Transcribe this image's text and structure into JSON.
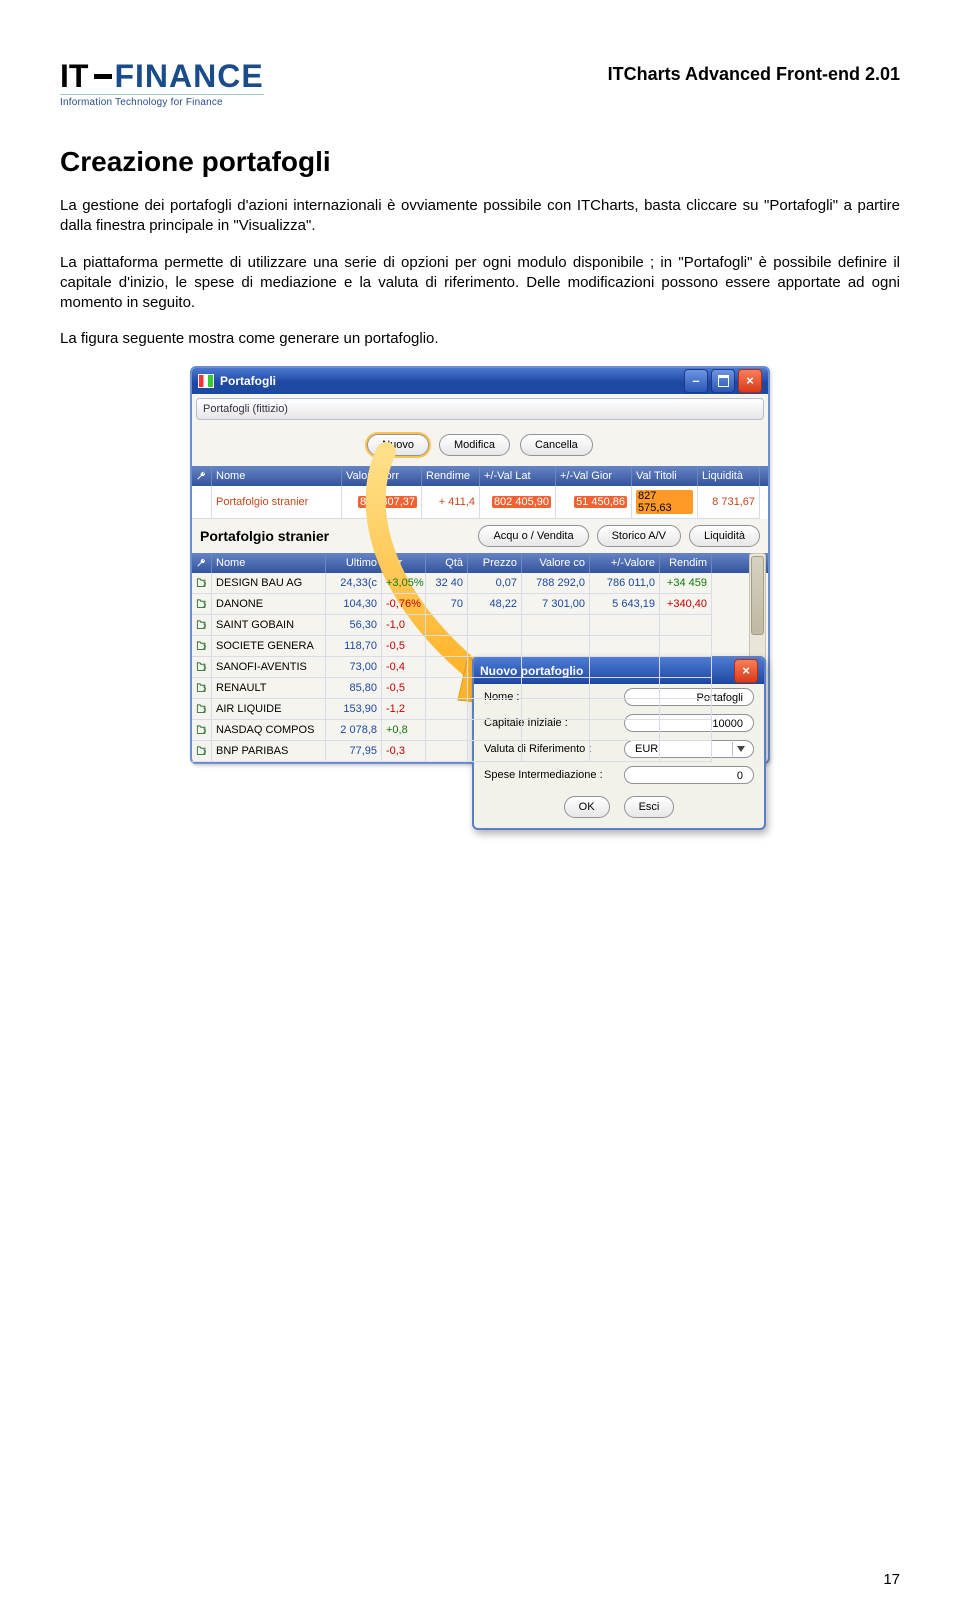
{
  "header": {
    "logo_it": "IT",
    "logo_finance": "FINANCE",
    "logo_sub": "Information Technology for Finance",
    "doc_title": "ITCharts Advanced Front-end 2.01"
  },
  "heading": "Creazione portafogli",
  "para1": "La gestione dei portafogli d'azioni internazionali è ovviamente possibile con ITCharts, basta cliccare su \"Portafogli\" a partire dalla finestra principale in \"Visualizza\".",
  "para2": "La piattaforma permette di utilizzare una serie di opzioni per ogni modulo disponibile ; in \"Portafogli\" è possibile definire il capitale d'inizio, le spese di mediazione e la valuta di riferimento. Delle modificazioni possono essere apportate ad ogni momento in seguito.",
  "para3": "La figura seguente mostra come generare un portafoglio.",
  "win": {
    "title": "Portafogli",
    "rail": "Portafogli (fittizio)",
    "buttons": {
      "nuovo": "Nuovo",
      "modifica": "Modifica",
      "cancella": "Cancella",
      "acq": "Acqu   o / Vendita",
      "storico": "Storico A/V",
      "liq": "Liquidità"
    },
    "portfolio_cols": [
      "Nome",
      "Valore corr",
      "Rendime",
      "+/-Val Lat",
      "+/-Val Gior",
      "Val Titoli",
      "Liquidità"
    ],
    "portfolio_row": {
      "name": "Portafolgio stranier",
      "c1": "836 307,37",
      "c2": "+   411,4",
      "c3": "802 405,90",
      "c4": "51 450,86",
      "c5": "827 575,63",
      "c6": "8 731,67"
    },
    "subtitle": "Portafolgio stranier",
    "asset_cols": [
      "Nome",
      "Ultimo",
      "Var",
      "Qtà",
      "Prezzo",
      "Valore co",
      "+/-Valore",
      "Rendim"
    ],
    "assets": [
      {
        "name": "DESIGN BAU AG",
        "ultimo": "24,33(c",
        "var": "+3,05%",
        "qta": "32 40",
        "prezzo": "0,07",
        "valore": "788 292,0",
        "pm": "786 011,0",
        "rend": "+34 459",
        "sign": "pos"
      },
      {
        "name": "DANONE",
        "ultimo": "104,30",
        "var": "-0,76%",
        "qta": "70",
        "prezzo": "48,22",
        "valore": "7 301,00",
        "pm": "5 643,19",
        "rend": "+340,40",
        "sign": "neg"
      },
      {
        "name": "SAINT GOBAIN",
        "ultimo": "56,30",
        "var": "-1,0",
        "qta": "",
        "prezzo": "",
        "valore": "",
        "pm": "",
        "rend": "",
        "sign": "neg"
      },
      {
        "name": "SOCIETE GENERA",
        "ultimo": "118,70",
        "var": "-0,5",
        "qta": "",
        "prezzo": "",
        "valore": "",
        "pm": "",
        "rend": "",
        "sign": "neg"
      },
      {
        "name": "SANOFI-AVENTIS",
        "ultimo": "73,00",
        "var": "-0,4",
        "qta": "",
        "prezzo": "",
        "valore": "",
        "pm": "",
        "rend": "",
        "sign": "neg"
      },
      {
        "name": "RENAULT",
        "ultimo": "85,80",
        "var": "-0,5",
        "qta": "",
        "prezzo": "",
        "valore": "",
        "pm": "",
        "rend": "",
        "sign": "neg"
      },
      {
        "name": "AIR LIQUIDE",
        "ultimo": "153,90",
        "var": "-1,2",
        "qta": "",
        "prezzo": "",
        "valore": "",
        "pm": "",
        "rend": "",
        "sign": "neg"
      },
      {
        "name": "NASDAQ COMPOS",
        "ultimo": "2 078,8",
        "var": "+0,8",
        "qta": "",
        "prezzo": "",
        "valore": "",
        "pm": "",
        "rend": "",
        "sign": "pos"
      },
      {
        "name": "BNP PARIBAS",
        "ultimo": "77,95",
        "var": "-0,3",
        "qta": "",
        "prezzo": "",
        "valore": "",
        "pm": "",
        "rend": "",
        "sign": "neg"
      }
    ]
  },
  "dialog": {
    "title": "Nuovo portafoglio",
    "rows": {
      "nome_lbl": "Nome :",
      "nome_val": "Portafogli",
      "cap_lbl": "Capitale Iniziale :",
      "cap_val": "10000",
      "val_lbl": "Valuta di Riferimento :",
      "val_val": "EUR",
      "sp_lbl": "Spese Intermediazione :",
      "sp_val": "0"
    },
    "ok": "OK",
    "esci": "Esci"
  },
  "page_num": "17"
}
